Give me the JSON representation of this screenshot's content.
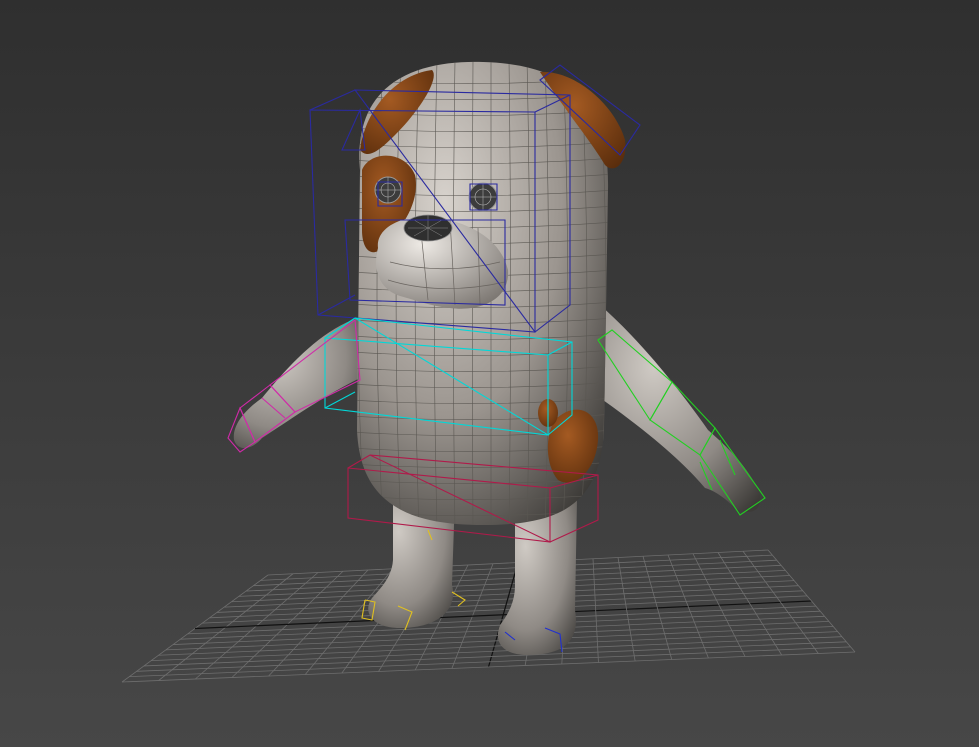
{
  "viewport": {
    "background_top": "#2f2f2f",
    "background_bottom": "#474747",
    "grid_color": "#6e6e6e",
    "grid_axis_color": "#111111"
  },
  "model": {
    "body_color": "#8f8a85",
    "spot_color": "#7a3f14",
    "wire_color": "#5a5752"
  },
  "bones": {
    "head_color": "#2a2aa0",
    "spine_color": "#00d8d8",
    "left_arm_color": "#d02aa8",
    "right_arm_color": "#22d022",
    "pelvis_color": "#b01a4a",
    "left_foot_color": "#e0c020",
    "right_foot_color": "#2030d0"
  }
}
